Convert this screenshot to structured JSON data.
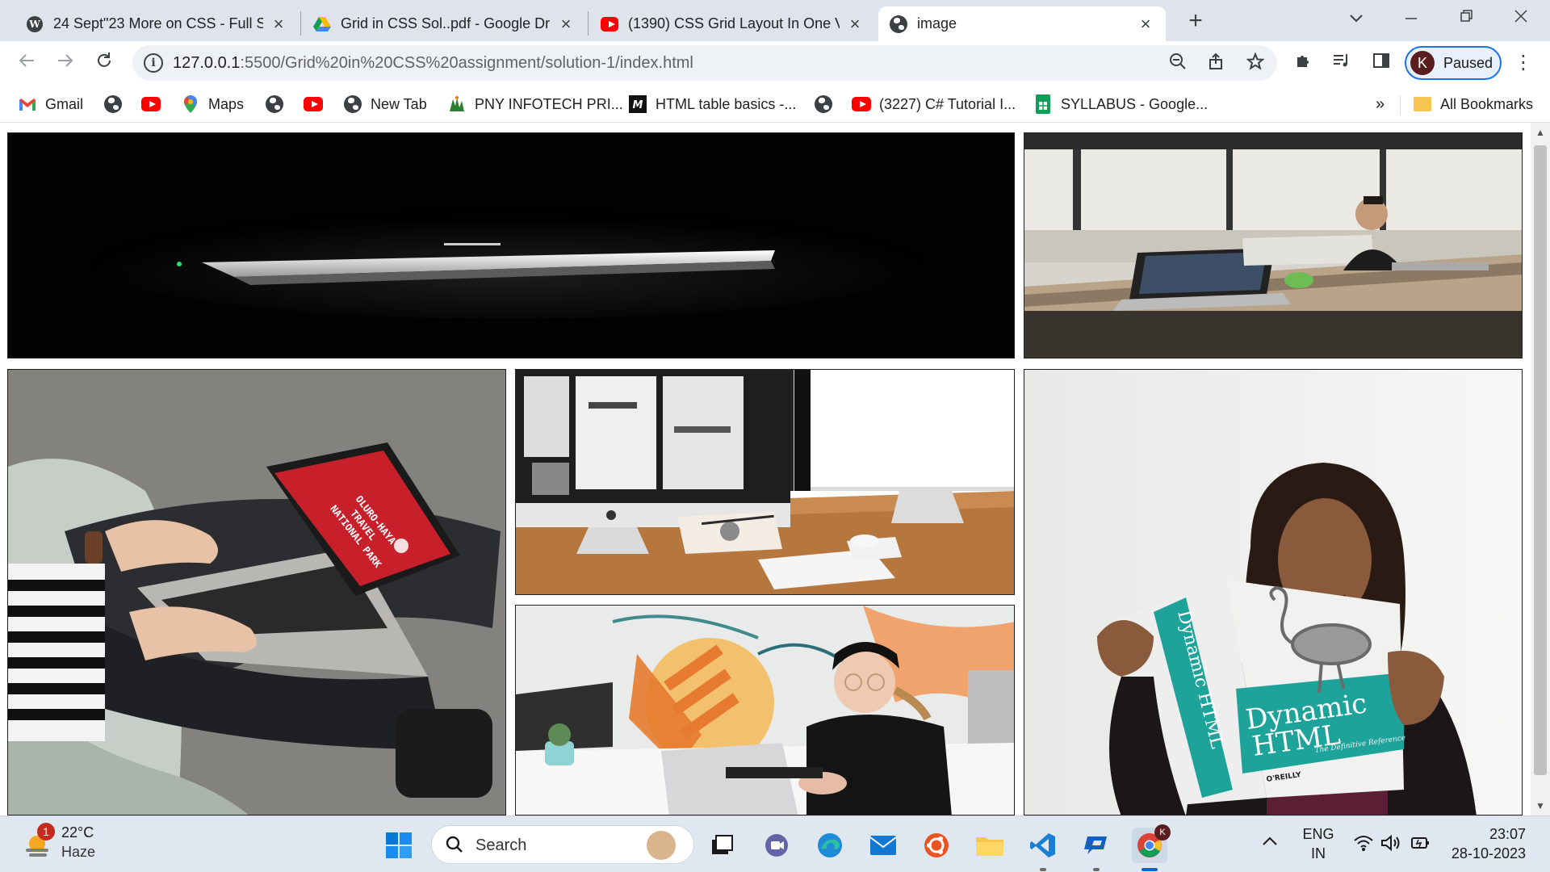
{
  "browser": {
    "tabs": [
      {
        "title": "24 Sept\"23 More on CSS - Full S",
        "icon": "wordpress-icon",
        "active": false
      },
      {
        "title": "Grid in CSS Sol..pdf - Google Dri",
        "icon": "google-drive-icon",
        "active": false
      },
      {
        "title": "(1390) CSS Grid Layout In One V",
        "icon": "youtube-icon",
        "active": false
      },
      {
        "title": "image",
        "icon": "globe-icon",
        "active": true
      }
    ],
    "new_tab": "+",
    "url_host": "127.0.0.1",
    "url_path": ":5500/Grid%20in%20CSS%20assignment/solution-1/index.html",
    "profile_initial": "K",
    "profile_label": "Paused",
    "profile_color": "#5b1e1e",
    "accent_color": "#1a73e8"
  },
  "bookmarks": [
    {
      "label": "Gmail",
      "icon": "gmail-icon"
    },
    {
      "label": "",
      "icon": "globe-icon"
    },
    {
      "label": "",
      "icon": "youtube-icon"
    },
    {
      "label": "Maps",
      "icon": "maps-icon"
    },
    {
      "label": "",
      "icon": "globe-icon"
    },
    {
      "label": "",
      "icon": "youtube-icon"
    },
    {
      "label": "New Tab",
      "icon": "globe-icon"
    },
    {
      "label": "PNY INFOTECH PRI...",
      "icon": "pny-icon"
    },
    {
      "label": "HTML table basics -...",
      "icon": "mdn-icon"
    },
    {
      "label": "",
      "icon": "globe-icon"
    },
    {
      "label": "(3227) C# Tutorial I...",
      "icon": "youtube-icon"
    },
    {
      "label": "SYLLABUS - Google...",
      "icon": "google-sheets-icon"
    }
  ],
  "bookmarks_overflow": "»",
  "all_bookmarks": "All Bookmarks",
  "gallery": [
    {
      "name": "dark-laptop-photo"
    },
    {
      "name": "office-laptops-photo"
    },
    {
      "name": "lap-laptop-photo"
    },
    {
      "name": "imac-desk-photo"
    },
    {
      "name": "designer-desk-photo"
    },
    {
      "name": "dynamic-html-book-photo"
    }
  ],
  "book": {
    "line1": "Dynamic",
    "line2": "HTML",
    "spine": "Dynamic HTML",
    "sub": "The Definitive Reference",
    "publisher": "O'REILLY"
  },
  "laptop_screen_text": [
    "OLURO-HAYA",
    "TRAVEL",
    "NATIONAL PARK"
  ],
  "taskbar": {
    "weather_temp": "22°C",
    "weather_desc": "Haze",
    "weather_badge": "1",
    "search_label": "Search",
    "language_line1": "ENG",
    "language_line2": "IN",
    "time": "23:07",
    "date": "28-10-2023",
    "chrome_badge": "K"
  }
}
